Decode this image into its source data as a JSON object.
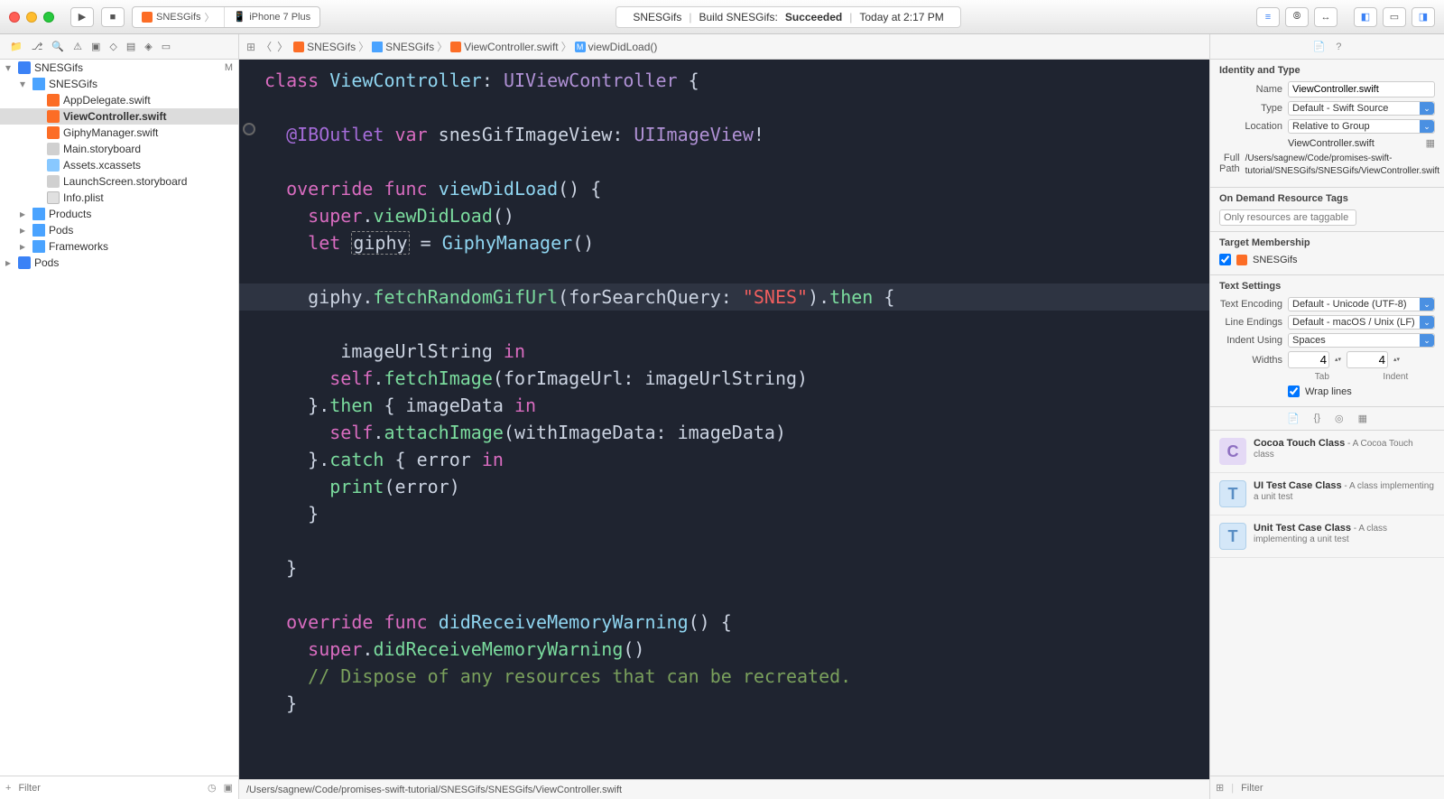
{
  "titlebar": {
    "scheme_app": "SNESGifs",
    "scheme_device": "iPhone 7 Plus",
    "status_project": "SNESGifs",
    "status_build": "Build SNESGifs:",
    "status_result": "Succeeded",
    "status_time": "Today at 2:17 PM"
  },
  "breadcrumb": {
    "project": "SNESGifs",
    "folder": "SNESGifs",
    "file": "ViewController.swift",
    "method": "viewDidLoad()"
  },
  "navigator": {
    "root": "SNESGifs",
    "root_badge": "M",
    "items": [
      {
        "label": "SNESGifs",
        "indent": 1,
        "icon": "folder",
        "disc": "▾"
      },
      {
        "label": "AppDelegate.swift",
        "indent": 2,
        "icon": "swift"
      },
      {
        "label": "ViewController.swift",
        "indent": 2,
        "icon": "swift",
        "selected": true
      },
      {
        "label": "GiphyManager.swift",
        "indent": 2,
        "icon": "swift"
      },
      {
        "label": "Main.storyboard",
        "indent": 2,
        "icon": "sb"
      },
      {
        "label": "Assets.xcassets",
        "indent": 2,
        "icon": "assets"
      },
      {
        "label": "LaunchScreen.storyboard",
        "indent": 2,
        "icon": "sb"
      },
      {
        "label": "Info.plist",
        "indent": 2,
        "icon": "plist"
      },
      {
        "label": "Products",
        "indent": 1,
        "icon": "folder",
        "disc": "▸"
      },
      {
        "label": "Pods",
        "indent": 1,
        "icon": "folder",
        "disc": "▸"
      },
      {
        "label": "Frameworks",
        "indent": 1,
        "icon": "folder",
        "disc": "▸"
      },
      {
        "label": "Pods",
        "indent": 0,
        "icon": "proj",
        "disc": "▸"
      }
    ],
    "filter_placeholder": "Filter"
  },
  "code_tokens": {
    "class": "class",
    "ViewController": "ViewController",
    "UIViewController": "UIViewController",
    "IBOutlet": "@IBOutlet",
    "var": "var",
    "snesGifImageView": "snesGifImageView",
    "UIImageView": "UIImageView",
    "override": "override",
    "func": "func",
    "viewDidLoad": "viewDidLoad",
    "super": "super",
    "let": "let",
    "giphy": "giphy",
    "GiphyManager": "GiphyManager",
    "fetchRandomGifUrl": "fetchRandomGifUrl",
    "forSearchQuery": "forSearchQuery",
    "SNES": "\"SNES\"",
    "then": "then",
    "imageUrlString": "imageUrlString",
    "in": "in",
    "self": "self",
    "fetchImage": "fetchImage",
    "forImageUrl": "forImageUrl",
    "imageData": "imageData",
    "attachImage": "attachImage",
    "withImageData": "withImageData",
    "catch": "catch",
    "error": "error",
    "print": "print",
    "didReceiveMemoryWarning": "didReceiveMemoryWarning",
    "comment": "// Dispose of any resources that can be recreated."
  },
  "editor_footer": "/Users/sagnew/Code/promises-swift-tutorial/SNESGifs/SNESGifs/ViewController.swift",
  "inspector": {
    "identity_header": "Identity and Type",
    "name_label": "Name",
    "name_value": "ViewController.swift",
    "type_label": "Type",
    "type_value": "Default - Swift Source",
    "location_label": "Location",
    "location_value": "Relative to Group",
    "location_file": "ViewController.swift",
    "fullpath_label": "Full Path",
    "fullpath_value": "/Users/sagnew/Code/promises-swift-tutorial/SNESGifs/SNESGifs/ViewController.swift",
    "ondemand_header": "On Demand Resource Tags",
    "ondemand_placeholder": "Only resources are taggable",
    "target_header": "Target Membership",
    "target_name": "SNESGifs",
    "text_header": "Text Settings",
    "enc_label": "Text Encoding",
    "enc_value": "Default - Unicode (UTF-8)",
    "lineend_label": "Line Endings",
    "lineend_value": "Default - macOS / Unix (LF)",
    "indent_label": "Indent Using",
    "indent_value": "Spaces",
    "widths_label": "Widths",
    "tab_value": "4",
    "indent_value_num": "4",
    "tab_caption": "Tab",
    "indent_caption": "Indent",
    "wrap_label": "Wrap lines",
    "lib": [
      {
        "icon": "c",
        "title": "Cocoa Touch Class",
        "desc": " - A Cocoa Touch class"
      },
      {
        "icon": "t",
        "title": "UI Test Case Class",
        "desc": " - A class implementing a unit test"
      },
      {
        "icon": "t",
        "title": "Unit Test Case Class",
        "desc": " - A class implementing a unit test"
      }
    ],
    "footer_filter": "Filter"
  }
}
